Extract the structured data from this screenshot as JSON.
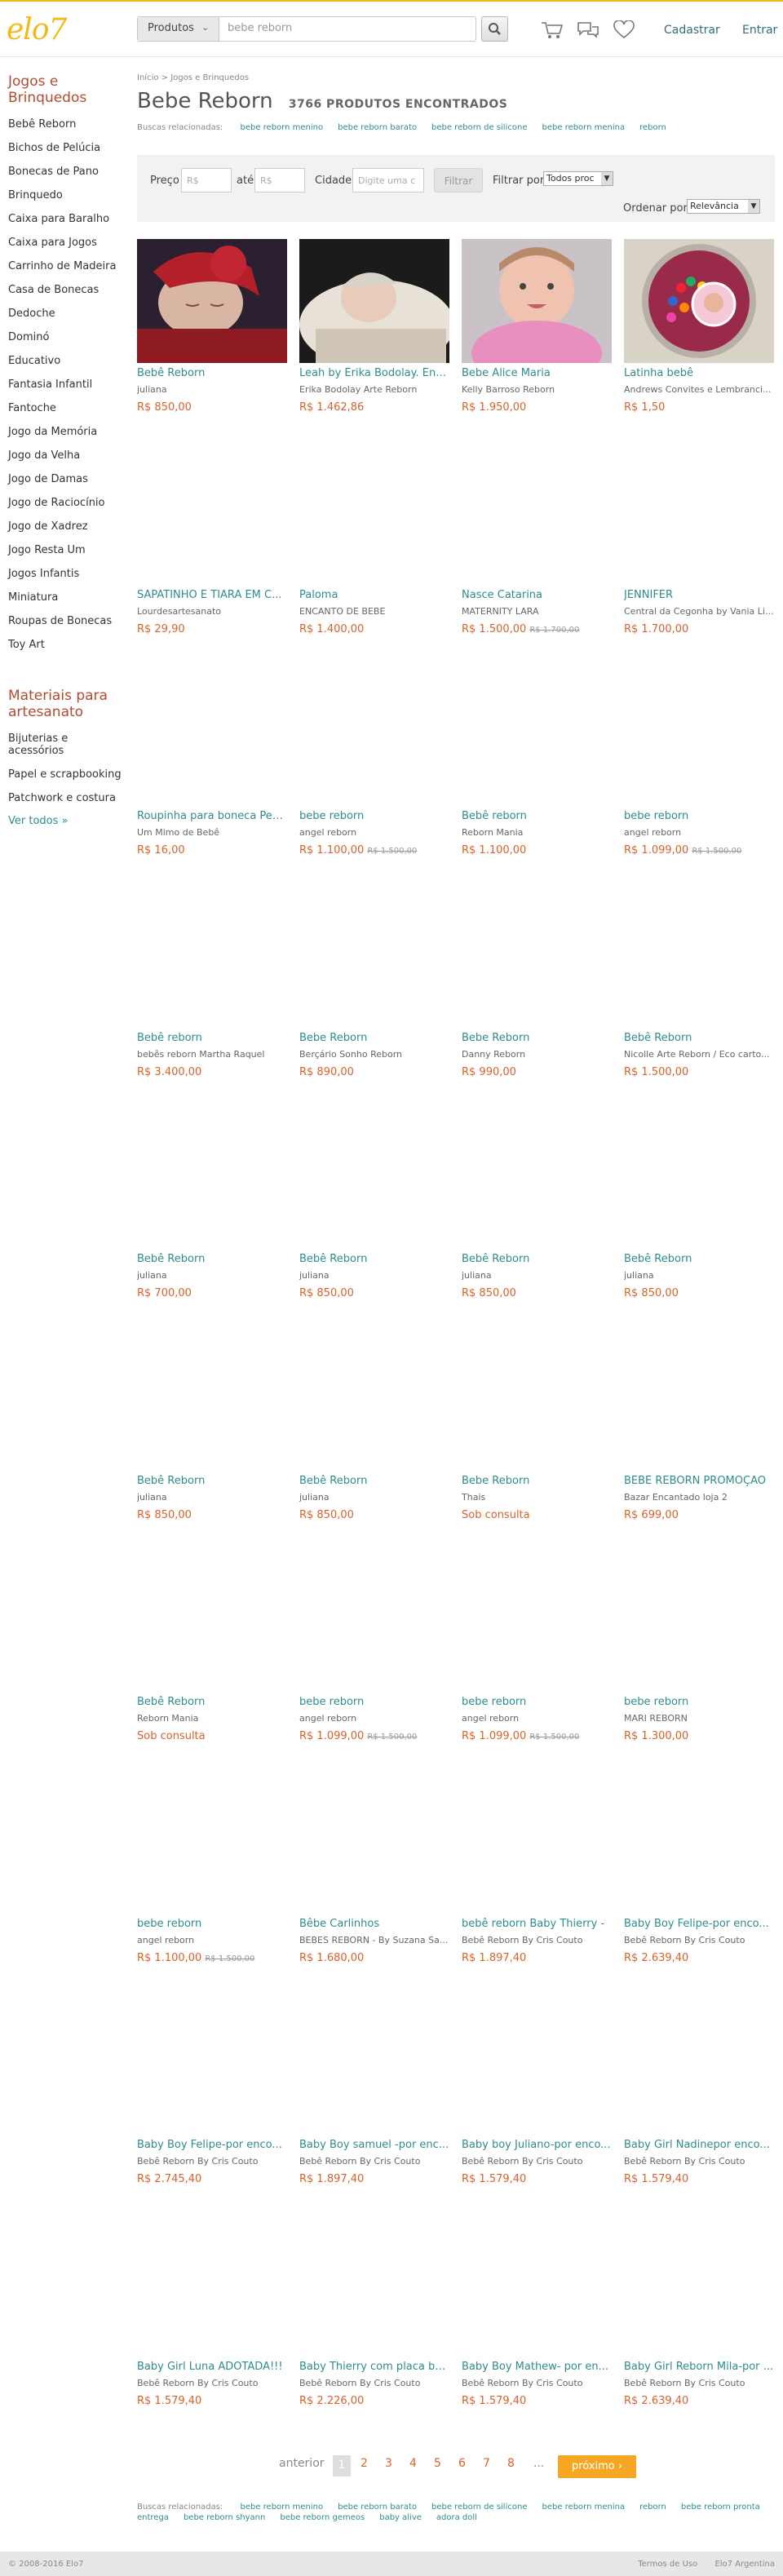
{
  "header": {
    "logo": "elo7",
    "search_category": "Produtos",
    "search_value": "bebe reborn",
    "register_label": "Cadastrar",
    "login_label": "Entrar"
  },
  "sidebar": {
    "section1_title": "Jogos e Brinquedos",
    "section1_items": [
      "Bebê Reborn",
      "Bichos de Pelúcia",
      "Bonecas de Pano",
      "Brinquedo",
      "Caixa para Baralho",
      "Caixa para Jogos",
      "Carrinho de Madeira",
      "Casa de Bonecas",
      "Dedoche",
      "Dominó",
      "Educativo",
      "Fantasia Infantil",
      "Fantoche",
      "Jogo da Memória",
      "Jogo da Velha",
      "Jogo de Damas",
      "Jogo de Raciocínio",
      "Jogo de Xadrez",
      "Jogo Resta Um",
      "Jogos Infantis",
      "Miniatura",
      "Roupas de Bonecas",
      "Toy Art"
    ],
    "section2_title": "Materiais para artesanato",
    "section2_items": [
      "Bijuterias e acessórios",
      "Papel e scrapbooking",
      "Patchwork e costura"
    ],
    "see_all": "Ver todos »"
  },
  "main": {
    "breadcrumb": "Início > Jogos e Brinquedos",
    "title": "Bebe Reborn",
    "count": "3766 PRODUTOS ENCONTRADOS",
    "related_label": "Buscas relacionadas:",
    "related": [
      "bebe reborn menino",
      "bebe reborn barato",
      "bebe reborn de silicone",
      "bebe reborn menina",
      "reborn"
    ]
  },
  "filters": {
    "price_label": "Preço",
    "price_min_placeholder": "R$",
    "to_label": "até",
    "price_max_placeholder": "R$",
    "city_label": "Cidade",
    "city_placeholder": "Digite uma c",
    "filter_button": "Filtrar",
    "filter_by_label": "Filtrar por",
    "filter_by_value": "Todos proc",
    "order_label": "Ordenar por",
    "order_value": "Relevância"
  },
  "products": [
    {
      "title": "Bebê Reborn",
      "seller": "juliana",
      "price": "R$ 850,00"
    },
    {
      "title": "Leah by Érika Bodolay. Enc...",
      "seller": "Erika Bodolay Arte Reborn",
      "price": "R$ 1.462,86"
    },
    {
      "title": "Bebe Alice Maria",
      "seller": "Kelly Barroso Reborn",
      "price": "R$ 1.950,00"
    },
    {
      "title": "Latinha bebê",
      "seller": "Andrews Convites e Lembranci...",
      "price": "R$ 1,50"
    },
    {
      "title": "SAPATINHO E TIARA EM C...",
      "seller": "Lourdesartesanato",
      "price": "R$ 29,90"
    },
    {
      "title": "Paloma",
      "seller": "ENCANTO DE BEBE",
      "price": "R$ 1.400,00"
    },
    {
      "title": "Nasce Catarina",
      "seller": "MATERNITY LARA",
      "price": "R$ 1.500,00",
      "old": "R$ 1.700,00"
    },
    {
      "title": "JENNIFER",
      "seller": "Central da Cegonha by Vania Li...",
      "price": "R$ 1.700,00"
    },
    {
      "title": "Roupinha para boneca Peq...",
      "seller": "Um Mimo de Bebê",
      "price": "R$ 16,00"
    },
    {
      "title": "bebe reborn",
      "seller": "angel reborn",
      "price": "R$ 1.100,00",
      "old": "R$ 1.500,00"
    },
    {
      "title": "Bebê reborn",
      "seller": "Reborn Mania",
      "price": "R$ 1.100,00"
    },
    {
      "title": "bebe reborn",
      "seller": "angel reborn",
      "price": "R$ 1.099,00",
      "old": "R$ 1.500,00"
    },
    {
      "title": "Bebê reborn",
      "seller": "bebês reborn Martha Raquel",
      "price": "R$ 3.400,00"
    },
    {
      "title": "Bebe Reborn",
      "seller": "Berçário Sonho Reborn",
      "price": "R$ 890,00"
    },
    {
      "title": "Bebe Reborn",
      "seller": "Danny Reborn",
      "price": "R$ 990,00"
    },
    {
      "title": "Bebê Reborn",
      "seller": "Nicolle Arte Reborn / Eco carto...",
      "price": "R$ 1.500,00"
    },
    {
      "title": "Bebê Reborn",
      "seller": "juliana",
      "price": "R$ 700,00"
    },
    {
      "title": "Bebê Reborn",
      "seller": "juliana",
      "price": "R$ 850,00"
    },
    {
      "title": "Bebê Reborn",
      "seller": "juliana",
      "price": "R$ 850,00"
    },
    {
      "title": "Bebê Reborn",
      "seller": "juliana",
      "price": "R$ 850,00"
    },
    {
      "title": "Bebê Reborn",
      "seller": "juliana",
      "price": "R$ 850,00"
    },
    {
      "title": "Bebê Reborn",
      "seller": "juliana",
      "price": "R$ 850,00"
    },
    {
      "title": "Bebe Reborn",
      "seller": "Thais",
      "price": "Sob consulta"
    },
    {
      "title": "BEBE REBORN PROMOÇÃO",
      "seller": "Bazar Encantado loja 2",
      "price": "R$ 699,00"
    },
    {
      "title": "Bebê Reborn",
      "seller": "Reborn Mania",
      "price": "Sob consulta"
    },
    {
      "title": "bebe reborn",
      "seller": "angel reborn",
      "price": "R$ 1.099,00",
      "old": "R$ 1.500,00"
    },
    {
      "title": "bebe reborn",
      "seller": "angel reborn",
      "price": "R$ 1.099,00",
      "old": "R$ 1.500,00"
    },
    {
      "title": "bebe reborn",
      "seller": "MARI REBORN",
      "price": "R$ 1.300,00"
    },
    {
      "title": "bebe reborn",
      "seller": "angel reborn",
      "price": "R$ 1.100,00",
      "old": "R$ 1.500,00"
    },
    {
      "title": "Bêbe Carlinhos",
      "seller": "BEBES REBORN - By Suzana Sa...",
      "price": "R$ 1.680,00"
    },
    {
      "title": "bebê reborn Baby Thierry -",
      "seller": "Bebê Reborn By Cris Couto",
      "price": "R$ 1.897,40"
    },
    {
      "title": "Baby Boy Felipe-por enco...",
      "seller": "Bebê Reborn By Cris Couto",
      "price": "R$ 2.639,40"
    },
    {
      "title": "Baby Boy Felipe-por enco...",
      "seller": "Bebê Reborn By Cris Couto",
      "price": "R$ 2.745,40"
    },
    {
      "title": "Baby Boy samuel -por enc...",
      "seller": "Bebê Reborn By Cris Couto",
      "price": "R$ 1.897,40"
    },
    {
      "title": "Baby boy Juliano-por enco...",
      "seller": "Bebê Reborn By Cris Couto",
      "price": "R$ 1.579,40"
    },
    {
      "title": "Baby Girl Nadinepor enco...",
      "seller": "Bebê Reborn By Cris Couto",
      "price": "R$ 1.579,40"
    },
    {
      "title": "Baby Girl Luna ADOTADA!!!",
      "seller": "Bebê Reborn By Cris Couto",
      "price": "R$ 1.579,40"
    },
    {
      "title": "Baby Thierry com placa ba...",
      "seller": "Bebê Reborn By Cris Couto",
      "price": "R$ 2.226,00"
    },
    {
      "title": "Baby Boy Mathew- por en...",
      "seller": "Bebê Reborn By Cris Couto",
      "price": "R$ 1.579,40"
    },
    {
      "title": "Baby Girl Reborn Mila-por ...",
      "seller": "Bebê Reborn By Cris Couto",
      "price": "R$ 2.639,40"
    }
  ],
  "pagination": {
    "prev": "anterior",
    "pages": [
      "1",
      "2",
      "3",
      "4",
      "5",
      "6",
      "7",
      "8"
    ],
    "ellipsis": "...",
    "next": "próximo ›"
  },
  "bottom_related": {
    "label": "Buscas relacionadas:",
    "items": [
      "bebe reborn menino",
      "bebe reborn barato",
      "bebe reborn de silicone",
      "bebe reborn menina",
      "reborn",
      "bebe reborn pronta entrega",
      "bebe reborn shyann",
      "bebe reborn gemeos",
      "baby alive",
      "adora doll"
    ]
  },
  "footer": {
    "copyright": "© 2008-2016 Elo7",
    "terms": "Termos de Uso",
    "country": "Elo7 Argentina"
  }
}
